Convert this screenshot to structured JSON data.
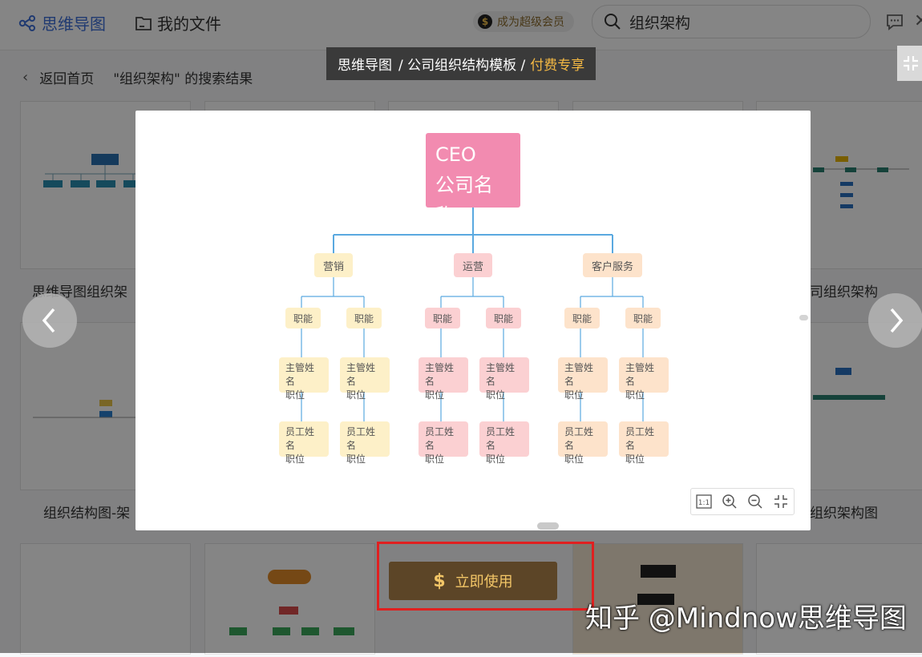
{
  "topbar": {
    "brand": "思维导图",
    "my_files": "我的文件",
    "vip_label": "成为超级会员",
    "search_value": "组织架构"
  },
  "back": {
    "label": "返回首页",
    "result": "\"组织架构\" 的搜索结果"
  },
  "cards": {
    "titles": [
      "思维导图组织架",
      "组织结构图-架",
      "司组织架构",
      "组织架构图"
    ]
  },
  "breadcrumb": {
    "part1": "思维导图",
    "part2": "/ 公司组织结构模板 /",
    "paid": "付费专享"
  },
  "orgchart": {
    "root_line1": "CEO",
    "root_line2": "公司名称",
    "branches": [
      {
        "label": "营销",
        "color": "#fdf0c8"
      },
      {
        "label": "运营",
        "color": "#fbd0d2"
      },
      {
        "label": "客户服务",
        "color": "#fde3cb"
      }
    ],
    "function_label": "职能",
    "manager_label": "主管姓名",
    "employee_label": "员工姓名",
    "position_label": "职位"
  },
  "zoom_controls": [
    "1:1",
    "zoom-in",
    "zoom-out",
    "fit"
  ],
  "use_button": {
    "icon": "$",
    "label": "立即使用"
  },
  "watermark": "知乎 @Mindnow思维导图",
  "colors": {
    "brand": "#3f6fd8",
    "connector": "#5aa9e0",
    "root": "#f28bb0",
    "use_button_bg": "#5c4527",
    "use_button_text": "#f3c667",
    "highlight_box": "#e02020"
  }
}
